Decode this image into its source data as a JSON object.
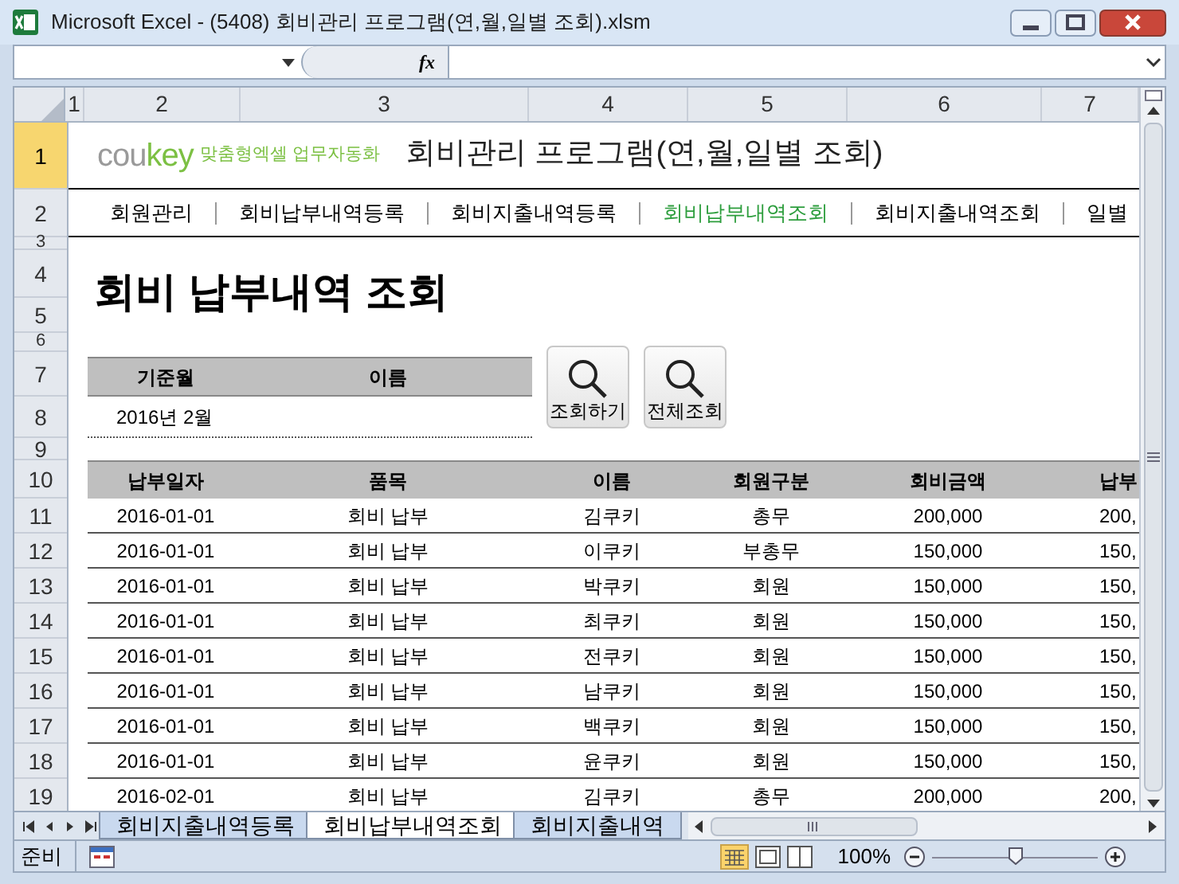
{
  "window": {
    "title": "Microsoft Excel - (5408) 회비관리 프로그램(연,월,일별 조회).xlsm"
  },
  "formula_bar": {
    "function_label": "fx"
  },
  "column_headers": [
    "1",
    "2",
    "3",
    "4",
    "5",
    "6",
    "7"
  ],
  "row_headers": [
    {
      "label": "1",
      "selected": true
    },
    {
      "label": "2",
      "selected": false
    },
    {
      "label": "3",
      "selected": false
    },
    {
      "label": "4",
      "selected": false
    },
    {
      "label": "5",
      "selected": false
    },
    {
      "label": "6",
      "selected": false
    },
    {
      "label": "7",
      "selected": false
    },
    {
      "label": "8",
      "selected": false
    },
    {
      "label": "9",
      "selected": false
    },
    {
      "label": "10",
      "selected": false
    },
    {
      "label": "11",
      "selected": false
    },
    {
      "label": "12",
      "selected": false
    },
    {
      "label": "13",
      "selected": false
    },
    {
      "label": "14",
      "selected": false
    },
    {
      "label": "15",
      "selected": false
    },
    {
      "label": "16",
      "selected": false
    },
    {
      "label": "17",
      "selected": false
    },
    {
      "label": "18",
      "selected": false
    },
    {
      "label": "19",
      "selected": false
    }
  ],
  "header": {
    "logo": "coukey",
    "tagline": "맞춤형엑셀 업무자동화",
    "title": "회비관리 프로그램(연,월,일별 조회)"
  },
  "nav": [
    {
      "label": "회원관리",
      "selected": false
    },
    {
      "label": "회비납부내역등록",
      "selected": false
    },
    {
      "label": "회비지출내역등록",
      "selected": false
    },
    {
      "label": "회비납부내역조회",
      "selected": true
    },
    {
      "label": "회비지출내역조회",
      "selected": false
    },
    {
      "label": "일별",
      "selected": false
    }
  ],
  "page_heading": "회비 납부내역 조회",
  "filter": {
    "labels": [
      "기준월",
      "이름"
    ],
    "month_value": "2016년 2월"
  },
  "buttons": [
    "조회하기",
    "전체조회"
  ],
  "table": {
    "columns": [
      "납부일자",
      "품목",
      "이름",
      "회원구분",
      "회비금액",
      "납부"
    ],
    "rows": [
      [
        "2016-01-01",
        "회비 납부",
        "김쿠키",
        "총무",
        "200,000",
        "200,"
      ],
      [
        "2016-01-01",
        "회비 납부",
        "이쿠키",
        "부총무",
        "150,000",
        "150,"
      ],
      [
        "2016-01-01",
        "회비 납부",
        "박쿠키",
        "회원",
        "150,000",
        "150,"
      ],
      [
        "2016-01-01",
        "회비 납부",
        "최쿠키",
        "회원",
        "150,000",
        "150,"
      ],
      [
        "2016-01-01",
        "회비 납부",
        "전쿠키",
        "회원",
        "150,000",
        "150,"
      ],
      [
        "2016-01-01",
        "회비 납부",
        "남쿠키",
        "회원",
        "150,000",
        "150,"
      ],
      [
        "2016-01-01",
        "회비 납부",
        "백쿠키",
        "회원",
        "150,000",
        "150,"
      ],
      [
        "2016-01-01",
        "회비 납부",
        "윤쿠키",
        "회원",
        "150,000",
        "150,"
      ],
      [
        "2016-02-01",
        "회비 납부",
        "김쿠키",
        "총무",
        "200,000",
        "200,"
      ]
    ]
  },
  "sheet_tabs": [
    {
      "label": "회비지출내역등록",
      "selected": false
    },
    {
      "label": "회비납부내역조회",
      "selected": true
    },
    {
      "label": "회비지출내역",
      "selected": false
    }
  ],
  "status_bar": {
    "status": "준비",
    "zoom": "100%",
    "zoom_slider": {
      "level": 0.5
    }
  }
}
